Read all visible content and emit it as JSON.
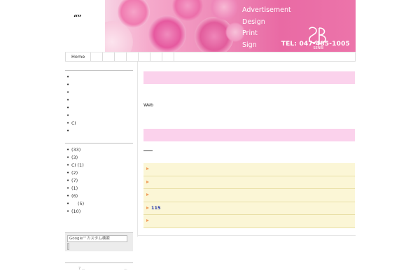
{
  "site": {
    "title": "“”"
  },
  "banner": {
    "menu": [
      "Advertisement",
      "Design",
      "Print",
      "Sign"
    ],
    "logo_text": "SENBI",
    "tel": "TEL: 047-485-1005",
    "accent": "#e96aa4"
  },
  "nav": {
    "items": [
      "Home",
      "",
      "",
      "",
      "",
      "",
      "",
      "",
      ""
    ]
  },
  "sidebar": {
    "pages": [
      "",
      "",
      "",
      "",
      "",
      "",
      "CI",
      ""
    ],
    "categories": [
      "(33)",
      "(3)",
      "CI (1)",
      "(2)",
      "(7)",
      "(1)",
      "(6)",
      "(5)",
      "(10)"
    ],
    "search_placeholder": "Google™カスタム検索",
    "footer_text": "7 ...",
    "footer_dots": "..."
  },
  "main": {
    "text": "Web",
    "news": [
      "",
      "",
      "",
      "115",
      ""
    ],
    "pink": "#fbd2ec",
    "news_bg": "#fbf6d6"
  }
}
